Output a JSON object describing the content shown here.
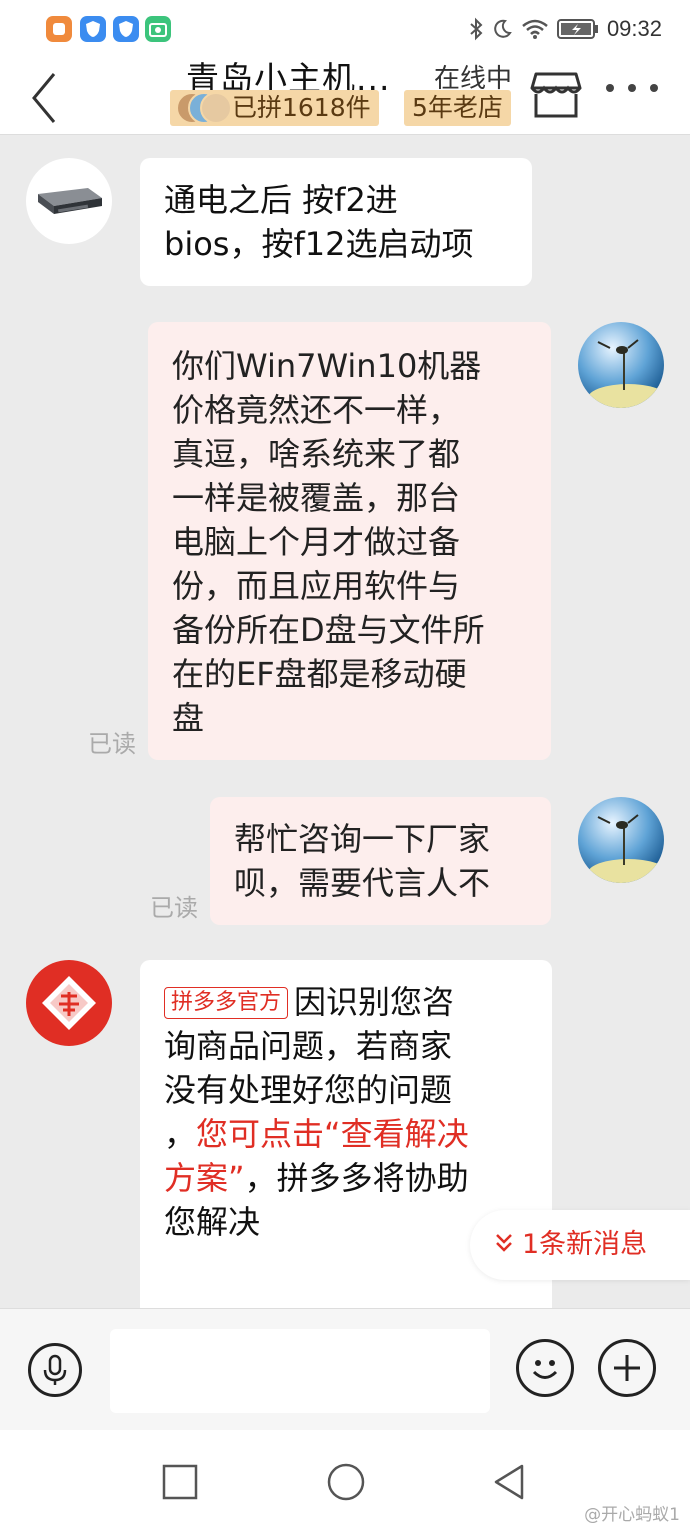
{
  "status_bar": {
    "time": "09:32",
    "app_icons": [
      "app-orange-icon",
      "shield-blue-icon",
      "shield-blue-icon",
      "camera-green-icon"
    ],
    "icons": [
      "bluetooth-icon",
      "moon-icon",
      "wifi-icon",
      "battery-charging-icon"
    ]
  },
  "header": {
    "title": "青岛小主机...",
    "status": "在线中",
    "badge_sold": "已拼1618件",
    "badge_years": "5年老店",
    "icons": [
      "back-icon",
      "store-icon",
      "more-icon"
    ]
  },
  "messages": [
    {
      "side": "left",
      "lines": [
        "通电之后 按f2进",
        "bios，按f12选启动项"
      ]
    },
    {
      "side": "right",
      "read": "已读",
      "lines": [
        "你们Win7Win10机器",
        "价格竟然还不一样，",
        "真逗，啥系统来了都",
        "一样是被覆盖，那台",
        "电脑上个月才做过备",
        "份，而且应用软件与",
        "备份所在D盘与文件所",
        "在的EF盘都是移动硬",
        "盘"
      ]
    },
    {
      "side": "right",
      "read": "已读",
      "lines": [
        "帮忙咨询一下厂家",
        "呗，需要代言人不"
      ]
    },
    {
      "side": "left",
      "tag": "拼多多官方",
      "line1": "因识别您咨",
      "line2": "询商品问题，若商家",
      "line3": "没有处理好您的问题",
      "line4_prefix": "，",
      "line4_red": "您可点击“查看解决",
      "line5_red": "方案”",
      "line5_rest": "，拼多多将协助",
      "line6": "您解决"
    }
  ],
  "new_message_pill": "1条新消息",
  "input_bar": {
    "icons": [
      "microphone-icon",
      "emoji-icon",
      "plus-icon"
    ]
  },
  "nav_bar": {
    "icons": [
      "recent-apps-icon",
      "home-icon",
      "back-triangle-icon"
    ]
  },
  "watermark": "@开心蚂蚁1",
  "colors": {
    "accent_red": "#e02e24",
    "badge_bg": "#f5d7a7",
    "pink_bubble": "#fdeeed",
    "chat_bg": "#ebebeb"
  }
}
